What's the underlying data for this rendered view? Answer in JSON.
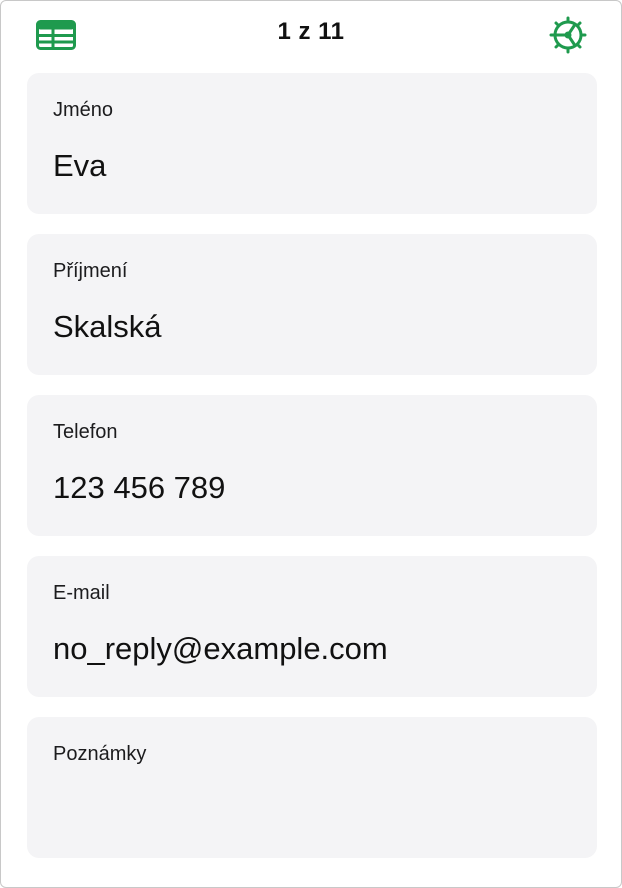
{
  "header": {
    "record_counter": "1 z 11",
    "left_icon": "table-icon",
    "right_icon": "gear-icon",
    "accent_color": "#1f9a4e"
  },
  "fields": [
    {
      "label": "Jméno",
      "value": "Eva"
    },
    {
      "label": "Příjmení",
      "value": "Skalská"
    },
    {
      "label": "Telefon",
      "value": "123 456 789"
    },
    {
      "label": "E-mail",
      "value": "no_reply@example.com"
    },
    {
      "label": "Poznámky",
      "value": ""
    }
  ]
}
